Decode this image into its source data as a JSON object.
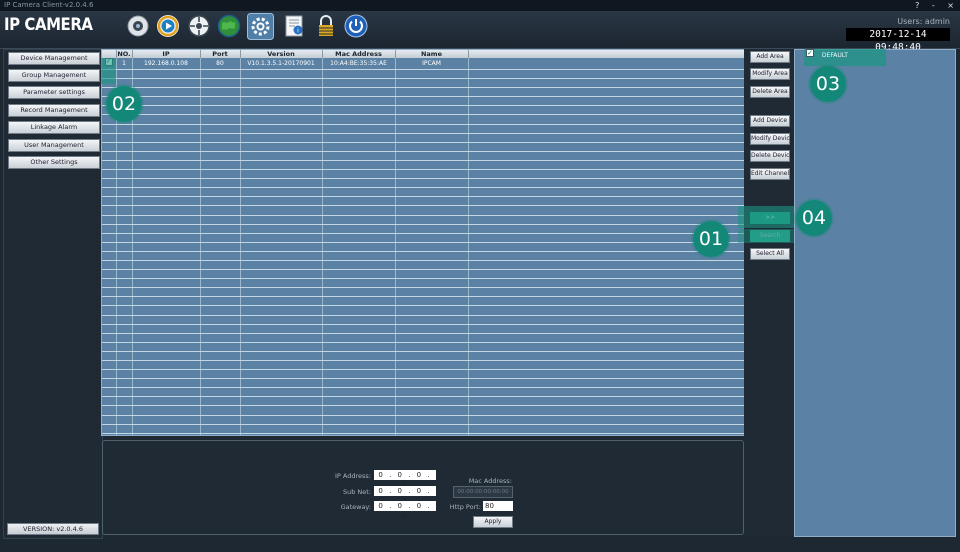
{
  "window": {
    "title": "IP Camera Client-v2.0.4.6",
    "help": "?",
    "minimize": "-",
    "close": "×"
  },
  "header": {
    "logo": "IP CAMERA",
    "user": "Users: admin",
    "datetime": "2017-12-14  09:48:40",
    "toolbar_icons": [
      "camera-icon",
      "playback-icon",
      "ptz-icon",
      "globe-icon",
      "settings-gear-icon",
      "info-icon",
      "lock-icon",
      "power-icon"
    ]
  },
  "sidebar": {
    "items": [
      {
        "label": "Device Management"
      },
      {
        "label": "Group Management"
      },
      {
        "label": "Parameter settings"
      },
      {
        "label": "Record Management"
      },
      {
        "label": "Linkage Alarm"
      },
      {
        "label": "User Management"
      },
      {
        "label": "Other Settings"
      }
    ],
    "version": "VERSION: v2.0.4.6"
  },
  "device_table": {
    "columns": [
      "",
      "NO.",
      "IP",
      "Port",
      "Version",
      "Mac Address",
      "Name"
    ],
    "rows": [
      {
        "checked": true,
        "no": "1",
        "ip": "192.168.0.108",
        "port": "80",
        "version": "V10.1.3.5.1-20170901",
        "mac": "10:A4:BE:35:35:AE",
        "name": "IPCAM"
      }
    ]
  },
  "actions": {
    "add_area": "Add Area",
    "modify_area": "Modify Area",
    "delete_area": "Delete Area",
    "add_device": "Add Device",
    "modify_device": "Modify Device",
    "delete_device": "Delete Device",
    "edit_channel": "Edit Channel",
    "transfer": ">>",
    "search": "Search",
    "select_all": "Select All"
  },
  "tree": {
    "root_label": "DEFAULT"
  },
  "network_form": {
    "ip_label": "IP Address:",
    "ip_value": "0 . 0 . 0 . 0",
    "subnet_label": "Sub Net:",
    "subnet_value": "0 . 0 . 0 . 0",
    "gateway_label": "Gateway:",
    "gateway_value": "0 . 0 . 0 . 0",
    "mac_label": "Mac Address:",
    "mac_value": "00:00:00:00:00:00",
    "http_label": "Http Port:",
    "http_value": "80",
    "apply": "Apply"
  },
  "annotations": {
    "b01": "01",
    "b02": "02",
    "b03": "03",
    "b04": "04",
    "accent": "#138878"
  }
}
